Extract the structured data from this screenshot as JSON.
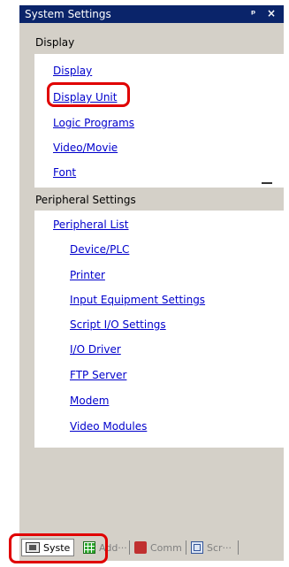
{
  "panel": {
    "title": "System Settings",
    "pin_glyph": "p",
    "close_glyph": "×"
  },
  "display_section": {
    "header": "Display",
    "items": [
      "Display",
      "Display Unit",
      "Logic Programs",
      "Video/Movie",
      "Font"
    ]
  },
  "peripheral_section": {
    "header": "Peripheral Settings",
    "list_label": "Peripheral List",
    "items": [
      "Device/PLC",
      "Printer",
      "Input Equipment Settings",
      "Script I/O Settings",
      "I/O Driver",
      "FTP Server",
      "Modem",
      "Video Modules"
    ]
  },
  "tabs": [
    {
      "label": "Syste",
      "icon": "monitor-icon",
      "active": true
    },
    {
      "label": "Add···",
      "icon": "grid-icon",
      "active": false
    },
    {
      "label": "Comm",
      "icon": "comm-icon",
      "active": false
    },
    {
      "label": "Scr···",
      "icon": "screen-icon",
      "active": false
    }
  ],
  "colors": {
    "title_bar": "#0a246a",
    "link": "#0000cc",
    "highlight": "#e00000",
    "panel_bg": "#d4d0c8"
  }
}
